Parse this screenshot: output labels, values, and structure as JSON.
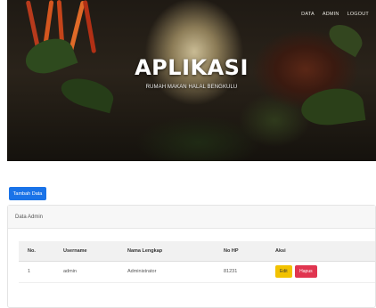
{
  "header": {
    "nav": [
      "DATA",
      "ADMIN",
      "LOGOUT"
    ],
    "title": "APLIKASI",
    "subtitle": "RUMAH MAKAN HALAL BENGKULU"
  },
  "toolbar": {
    "add_label": "Tambah Data"
  },
  "card": {
    "title": "Data Admin"
  },
  "table": {
    "columns": [
      "No.",
      "Username",
      "Nama Lengkap",
      "No HP",
      "Aksi"
    ],
    "rows": [
      {
        "no": "1",
        "username": "admin",
        "nama": "Administrator",
        "hp": "81231",
        "edit": "Edit",
        "hapus": "Hapus"
      }
    ]
  },
  "colors": {
    "primary": "#1a73e8",
    "edit": "#f2c200",
    "delete": "#e03550"
  }
}
